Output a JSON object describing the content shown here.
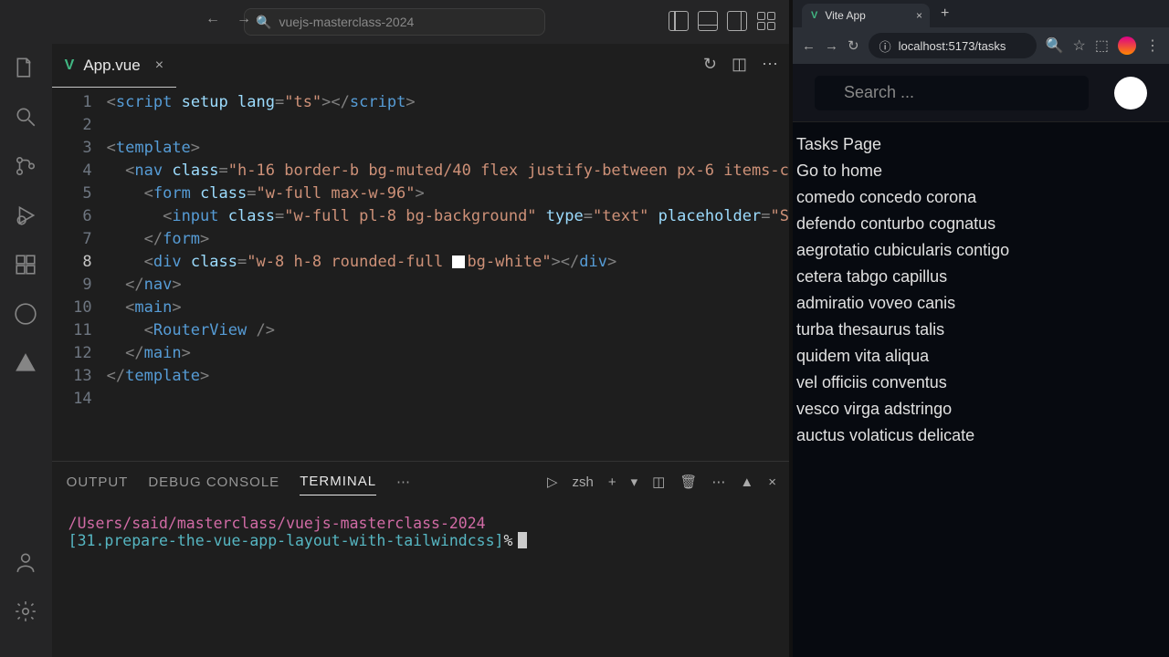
{
  "titlebar": {
    "search_text": "vuejs-masterclass-2024"
  },
  "tab": {
    "icon": "V",
    "name": "App.vue"
  },
  "code": {
    "lines": [
      {
        "n": 1,
        "html": "<span class='t-punc'>&lt;</span><span class='t-tag'>script</span> <span class='t-attr'>setup</span> <span class='t-attr'>lang</span><span class='t-punc'>=</span><span class='t-str'>\"ts\"</span><span class='t-punc'>&gt;&lt;/</span><span class='t-tag'>script</span><span class='t-punc'>&gt;</span>"
      },
      {
        "n": 2,
        "html": ""
      },
      {
        "n": 3,
        "html": "<span class='t-punc'>&lt;</span><span class='t-tag'>template</span><span class='t-punc'>&gt;</span>"
      },
      {
        "n": 4,
        "html": "  <span class='t-punc'>&lt;</span><span class='t-tag'>nav</span> <span class='t-attr'>class</span><span class='t-punc'>=</span><span class='t-str'>\"h-16 border-b bg-muted/40 flex justify-between px-6 items-c</span>"
      },
      {
        "n": 5,
        "html": "    <span class='t-punc'>&lt;</span><span class='t-tag'>form</span> <span class='t-attr'>class</span><span class='t-punc'>=</span><span class='t-str'>\"w-full max-w-96\"</span><span class='t-punc'>&gt;</span>"
      },
      {
        "n": 6,
        "html": "      <span class='t-punc'>&lt;</span><span class='t-tag'>input</span> <span class='t-attr'>class</span><span class='t-punc'>=</span><span class='t-str'>\"w-full pl-8 bg-background\"</span> <span class='t-attr'>type</span><span class='t-punc'>=</span><span class='t-str'>\"text\"</span> <span class='t-attr'>placeholder</span><span class='t-punc'>=</span><span class='t-str'>\"S</span>"
      },
      {
        "n": 7,
        "html": "    <span class='t-punc'>&lt;/</span><span class='t-tag'>form</span><span class='t-punc'>&gt;</span>"
      },
      {
        "n": 8,
        "html": "    <span class='t-punc'>&lt;</span><span class='t-tag'>div</span> <span class='t-attr'>class</span><span class='t-punc'>=</span><span class='t-str'>\"w-8 h-8 rounded-full <span class='t-swatch'></span>bg-white\"</span><span class='t-punc'>&gt;&lt;/</span><span class='t-tag'>div</span><span class='t-punc'>&gt;</span>"
      },
      {
        "n": 9,
        "html": "  <span class='t-punc'>&lt;/</span><span class='t-tag'>nav</span><span class='t-punc'>&gt;</span>"
      },
      {
        "n": 10,
        "html": "  <span class='t-punc'>&lt;</span><span class='t-tag'>main</span><span class='t-punc'>&gt;</span>"
      },
      {
        "n": 11,
        "html": "    <span class='t-punc'>&lt;</span><span class='t-tag'>RouterView</span> <span class='t-punc'>/&gt;</span>"
      },
      {
        "n": 12,
        "html": "  <span class='t-punc'>&lt;/</span><span class='t-tag'>main</span><span class='t-punc'>&gt;</span>"
      },
      {
        "n": 13,
        "html": "<span class='t-punc'>&lt;/</span><span class='t-tag'>template</span><span class='t-punc'>&gt;</span>"
      },
      {
        "n": 14,
        "html": ""
      }
    ],
    "current_line": 8
  },
  "panel": {
    "tabs": {
      "output": "OUTPUT",
      "debug": "DEBUG CONSOLE",
      "terminal": "TERMINAL"
    },
    "shell": "zsh"
  },
  "terminal": {
    "cwd": "/Users/said/masterclass/vuejs-masterclass-2024",
    "branch": "[31.prepare-the-vue-app-layout-with-tailwindcss]",
    "prompt_char": "%"
  },
  "browser": {
    "tab_title": "Vite App",
    "url": "localhost:5173/tasks"
  },
  "page": {
    "search_placeholder": "Search ...",
    "heading": "Tasks Page",
    "home_link": "Go to home",
    "tasks": [
      "comedo concedo corona",
      "defendo conturbo cognatus",
      "aegrotatio cubicularis contigo",
      "cetera tabgo capillus",
      "admiratio voveo canis",
      "turba thesaurus talis",
      "quidem vita aliqua",
      "vel officiis conventus",
      "vesco virga adstringo",
      "auctus volaticus delicate"
    ]
  }
}
